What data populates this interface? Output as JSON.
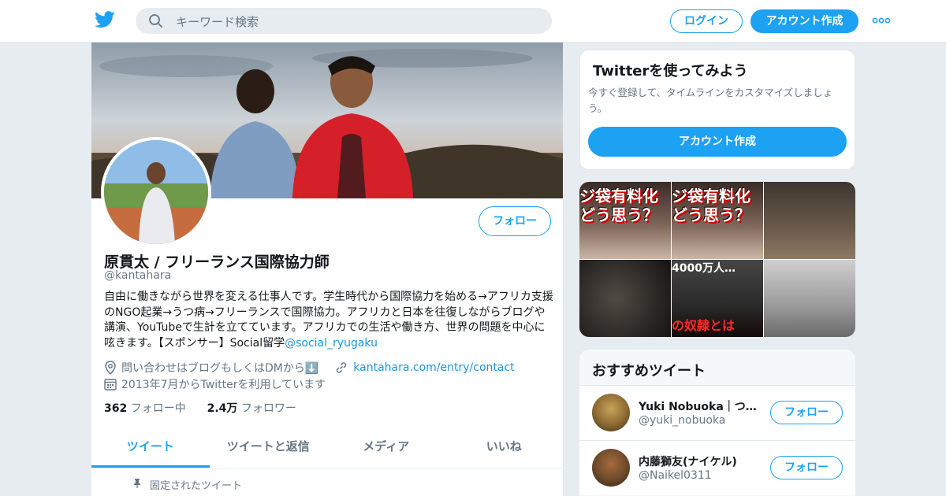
{
  "header": {
    "search_placeholder": "キーワード検索",
    "login_label": "ログイン",
    "signup_label": "アカウント作成"
  },
  "profile": {
    "follow_label": "フォロー",
    "name": "原貫太 / フリーランス国際協力師",
    "handle": "@kantahara",
    "bio_text": "自由に働きながら世界を変える仕事人です。学生時代から国際協力を始める→アフリカ支援のNGO起業→うつ病→フリーランスで国際協力。アフリカと日本を往復しながらブログや講演、YouTubeで生計を立てています。アフリカでの生活や働き方、世界の問題を中心に呟きます。【スポンサー】Social留学",
    "bio_mention": "@social_ryugaku",
    "location": "問い合わせはブログもしくはDMから⬇️",
    "url": "kantahara.com/entry/contact",
    "joined": "2013年7月からTwitterを利用しています",
    "following_count": "362",
    "following_label": "フォロー中",
    "followers_count": "2.4万",
    "followers_label": "フォロワー",
    "tabs": [
      "ツイート",
      "ツイートと返信",
      "メディア",
      "いいね"
    ],
    "pinned_label": "固定されたツイート"
  },
  "signup_card": {
    "title": "Twitterを使ってみよう",
    "text": "今すぐ登録して、タイムラインをカスタマイズしましょう。",
    "button": "アカウント作成"
  },
  "media": {
    "tile1_text": "ジ袋有料化\nどう思う？",
    "tile2_text": "ジ袋有料化\nどう思う？",
    "tile5_top": "4000万人…",
    "tile5_bottom": "の奴隷とは"
  },
  "recommendations": {
    "title": "おすすめツイート",
    "items": [
      {
        "name": "Yuki Nobuoka｜つぎ...",
        "handle": "@yuki_nobuoka",
        "follow": "フォロー"
      },
      {
        "name": "内藤獅友(ナイケル)",
        "handle": "@Naikel0311",
        "follow": "フォロー"
      }
    ]
  },
  "colors": {
    "accent": "#1da1f2",
    "link": "#1b95e0",
    "background": "#e6ecf0",
    "muted": "#657786"
  }
}
